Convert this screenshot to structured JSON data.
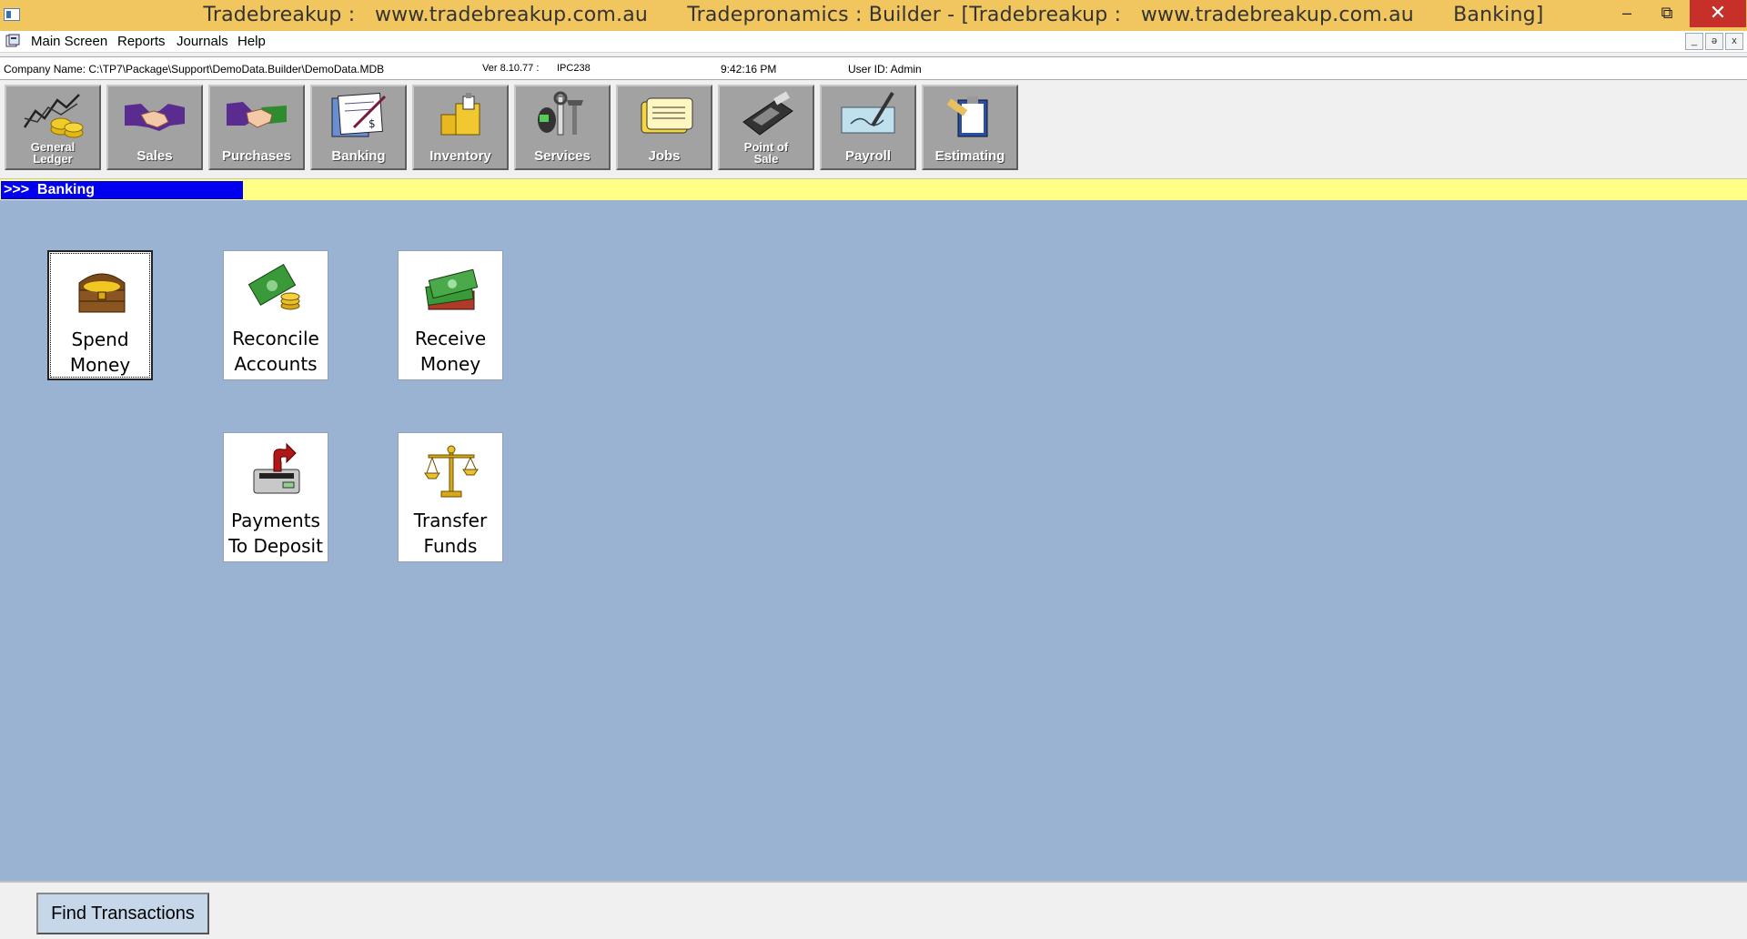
{
  "window": {
    "title": "Tradebreakup :   www.tradebreakup.com.au      Tradepronamics : Builder - [Tradebreakup :   www.tradebreakup.com.au      Banking]",
    "minimize": "–",
    "maximize": "⧉",
    "close": "✕"
  },
  "menu": {
    "items": [
      "Main Screen",
      "Reports",
      "Journals",
      "Help"
    ],
    "mdi_buttons": [
      "_",
      "ə",
      "x"
    ]
  },
  "status": {
    "company": "Company Name: C:\\TP7\\Package\\Support\\DemoData.Builder\\DemoData.MDB",
    "version": "Ver 8.10.77  :",
    "code": "IPC238",
    "time": "9:42:16 PM",
    "user": "User ID: Admin"
  },
  "toolbar": {
    "buttons": [
      {
        "label": "General Ledger",
        "icon": "general-ledger-icon"
      },
      {
        "label": "Sales",
        "icon": "sales-handshake-icon"
      },
      {
        "label": "Purchases",
        "icon": "purchases-handshake-icon"
      },
      {
        "label": "Banking",
        "icon": "banking-cheque-icon"
      },
      {
        "label": "Inventory",
        "icon": "inventory-boxes-icon"
      },
      {
        "label": "Services",
        "icon": "services-tools-icon"
      },
      {
        "label": "Jobs",
        "icon": "jobs-cards-icon"
      },
      {
        "label": "Point of Sale",
        "icon": "eftpos-terminal-icon"
      },
      {
        "label": "Payroll",
        "icon": "payroll-cheque-pen-icon"
      },
      {
        "label": "Estimating",
        "icon": "estimating-clipboard-icon"
      }
    ]
  },
  "breadcrumb": ">>>  Banking",
  "tiles": [
    {
      "label": "Spend\nMoney",
      "icon": "treasure-chest-icon"
    },
    {
      "label": "Reconcile\nAccounts",
      "icon": "banknote-coins-icon"
    },
    {
      "label": "Receive\nMoney",
      "icon": "cash-stack-icon"
    },
    {
      "label": "Payments\nTo Deposit",
      "icon": "deposit-box-icon"
    },
    {
      "label": "Transfer\nFunds",
      "icon": "balance-scale-icon"
    }
  ],
  "footer": {
    "find_transactions": "Find Transactions"
  },
  "colors": {
    "titlebar": "#f2c65e",
    "close_button": "#c7302a",
    "workspace": "#9ab3d2",
    "breadcrumb_bg": "#0000ee",
    "breadcrumb_strip": "#ffff88",
    "toolbar_button": "#a2a2a2",
    "find_button": "#c6d7ea"
  }
}
